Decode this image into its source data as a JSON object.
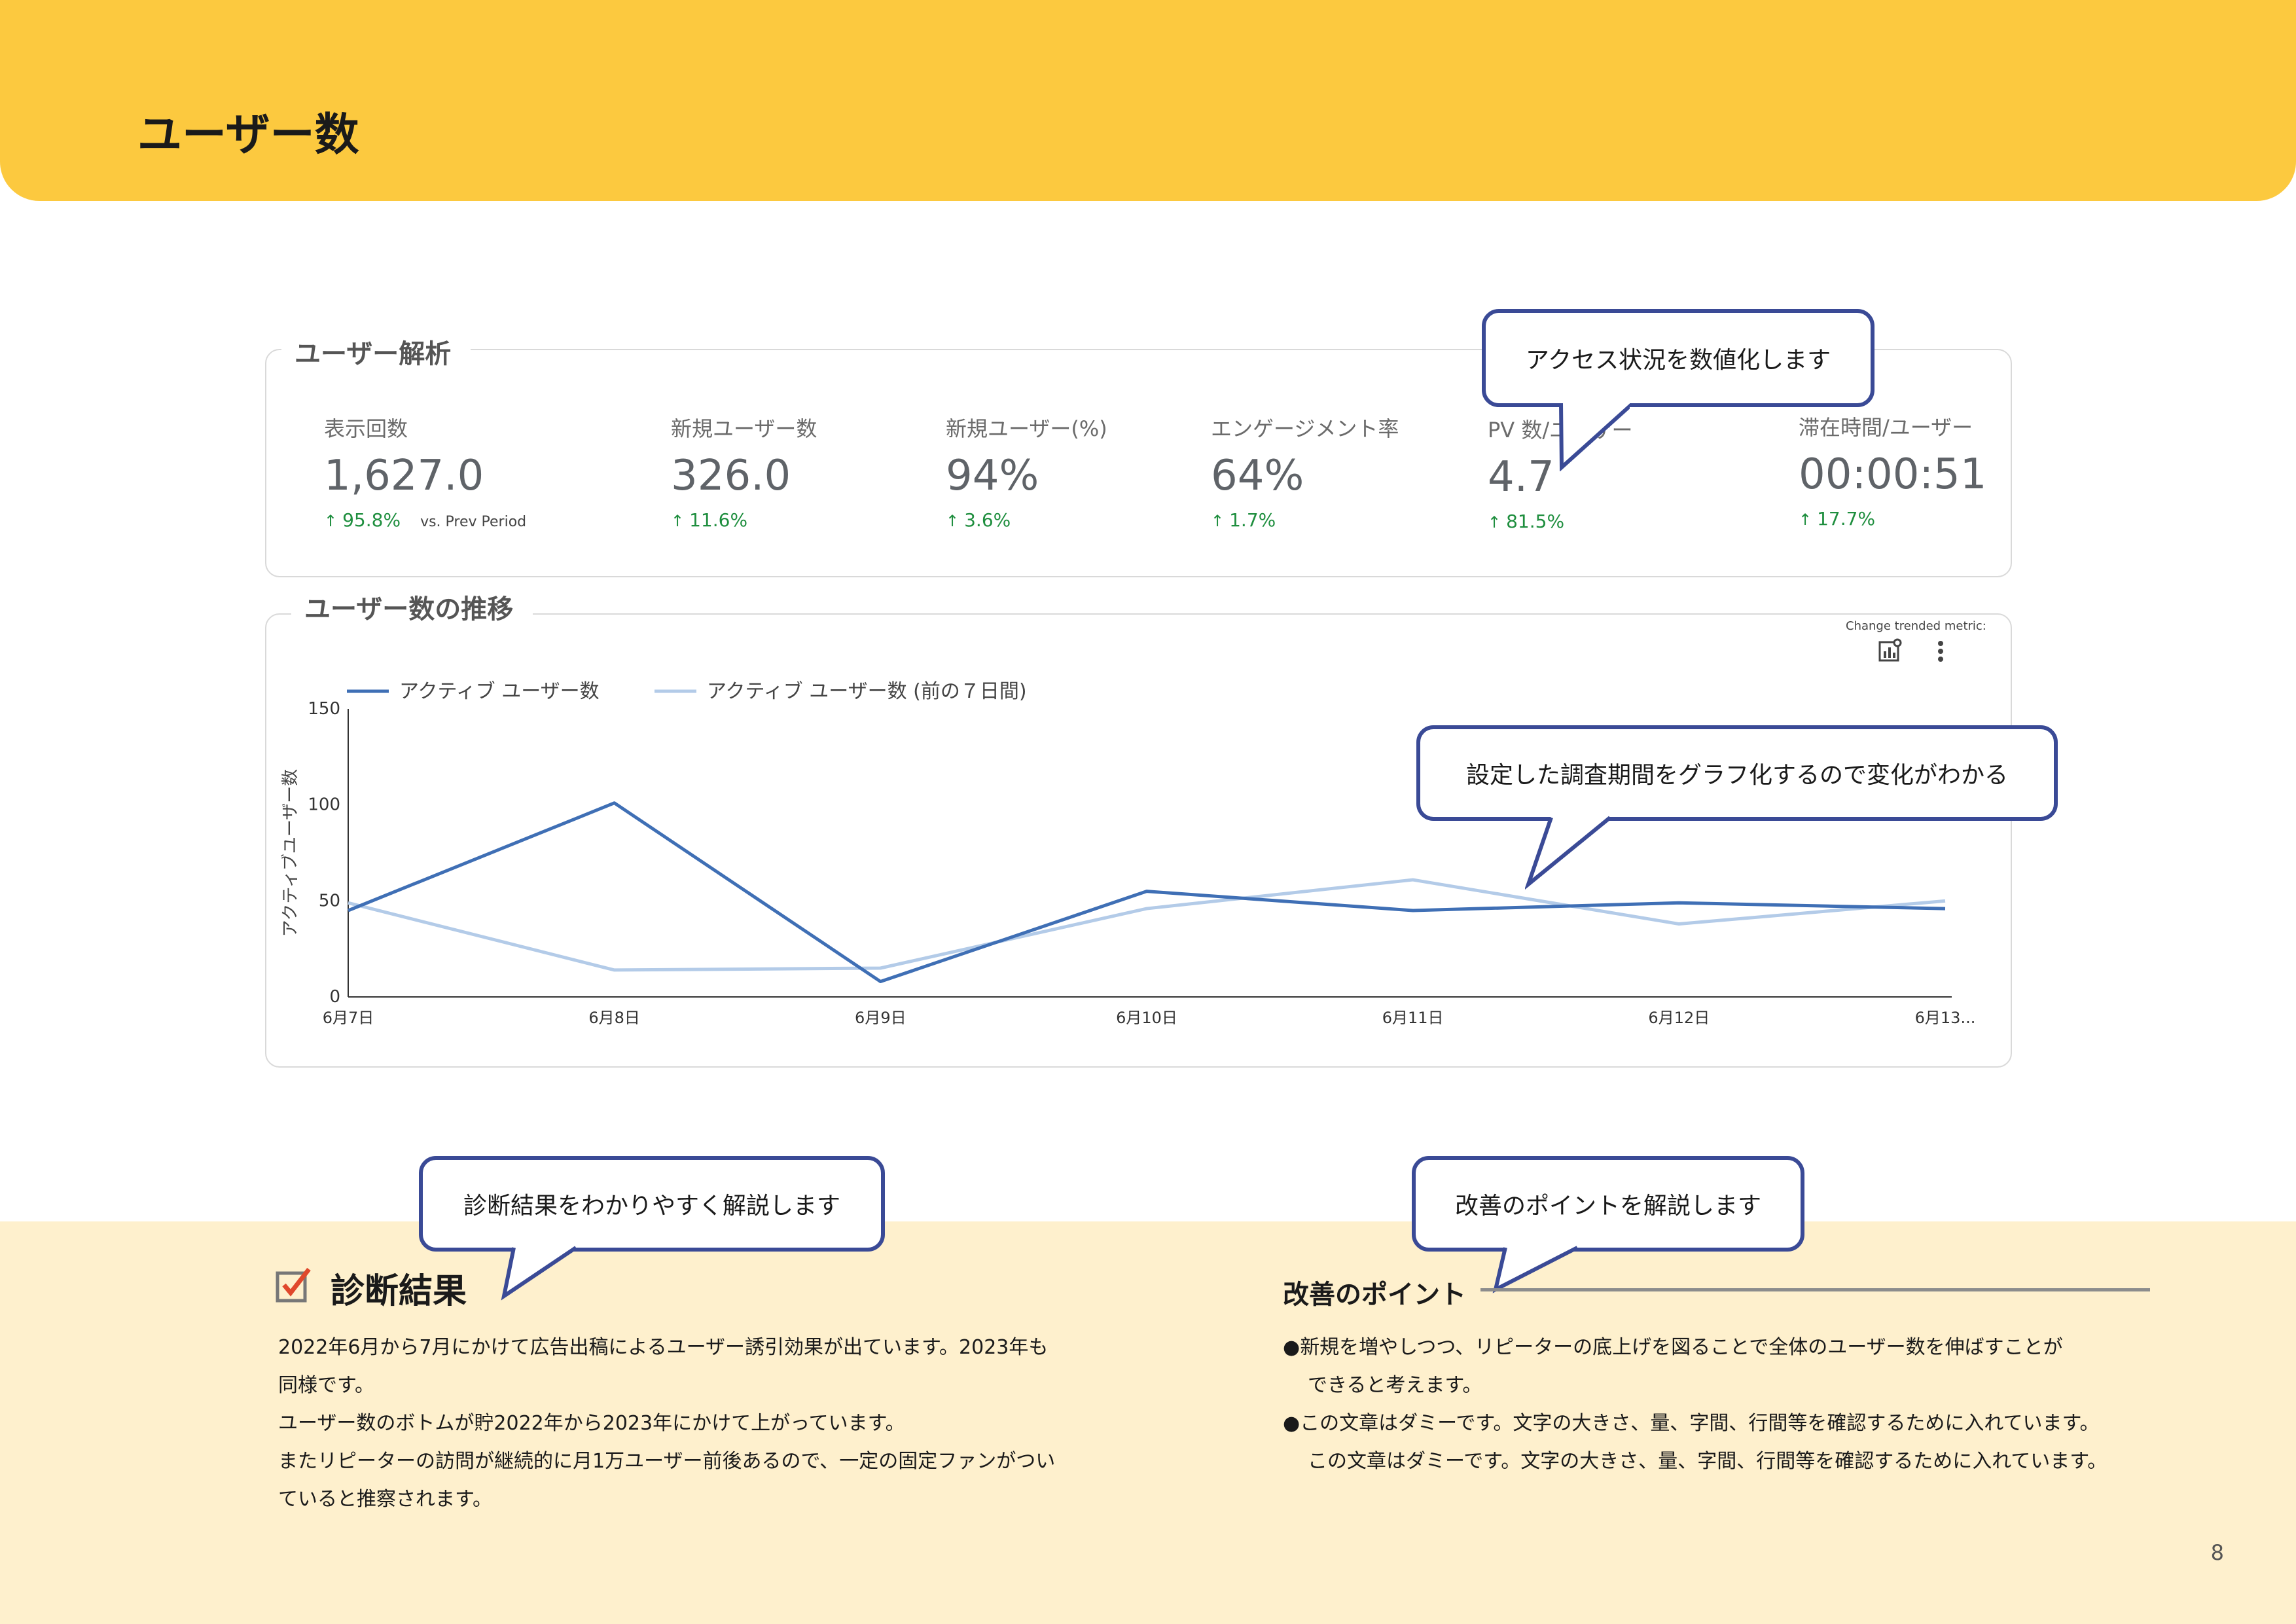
{
  "header": {
    "title": "ユーザー数"
  },
  "analysis_card": {
    "label": "ユーザー解析",
    "metrics": [
      {
        "label": "表示回数",
        "value": "1,627.0",
        "change": "95.8%",
        "note": "vs. Prev Period"
      },
      {
        "label": "新規ユーザー数",
        "value": "326.0",
        "change": "11.6%"
      },
      {
        "label": "新規ユーザー(%)",
        "value": "94%",
        "change": "3.6%"
      },
      {
        "label": "エンゲージメント率",
        "value": "64%",
        "change": "1.7%"
      },
      {
        "label": "PV 数/ユーザー",
        "value": "4.7",
        "change": "81.5%"
      },
      {
        "label": "滞在時間/ユーザー",
        "value": "00:00:51",
        "change": "17.7%"
      }
    ],
    "up_arrow": "↑"
  },
  "trend_card": {
    "label": "ユーザー数の推移",
    "change_metric": "Change trended metric:",
    "icons": [
      "chart-settings-icon",
      "more-vert-icon"
    ]
  },
  "chart_data": {
    "type": "line",
    "categories": [
      "6月7日",
      "6月8日",
      "6月9日",
      "6月10日",
      "6月11日",
      "6月12日",
      "6月13..."
    ],
    "series": [
      {
        "name": "アクティブ ユーザー数",
        "color": "#3f6fb5",
        "values": [
          45,
          101,
          8,
          55,
          45,
          49,
          46
        ]
      },
      {
        "name": "アクティブ ユーザー数 (前の７日間)",
        "color": "#b3cbe8",
        "values": [
          49,
          14,
          15,
          46,
          61,
          38,
          50
        ]
      }
    ],
    "ylabel": "アクティブユーザー数",
    "yticks": [
      0,
      50,
      100,
      150
    ],
    "ylim": [
      0,
      150
    ],
    "grid": false,
    "legend": "top-left"
  },
  "callouts": {
    "access": "アクセス状況を数値化します",
    "graph": "設定した調査期間をグラフ化するので変化がわかる",
    "diagnosis": "診断結果をわかりやすく解説します",
    "improve": "改善のポイントを解説します"
  },
  "diagnosis": {
    "title": "診断結果",
    "check_icon": "checkbox-checked-icon",
    "lines": [
      "2022年6月から7月にかけて広告出稿によるユーザー誘引効果が出ています。2023年も",
      "同様です。",
      "ユーザー数のボトムが貯2022年から2023年にかけて上がっています。",
      "またリピーターの訪問が継続的に月1万ユーザー前後あるので、一定の固定ファンがつい",
      "ていると推察されます。"
    ]
  },
  "improvement": {
    "title": "改善のポイント",
    "bullet": "●",
    "items": [
      [
        "新規を増やしつつ、リピーターの底上げを図ることで全体のユーザー数を伸ばすことが",
        "できると考えます。"
      ],
      [
        "この文章はダミーです。文字の大きさ、量、字間、行間等を確認するために入れています。",
        "この文章はダミーです。文字の大きさ、量、字間、行間等を確認するために入れています。"
      ]
    ]
  },
  "page_number": "8"
}
